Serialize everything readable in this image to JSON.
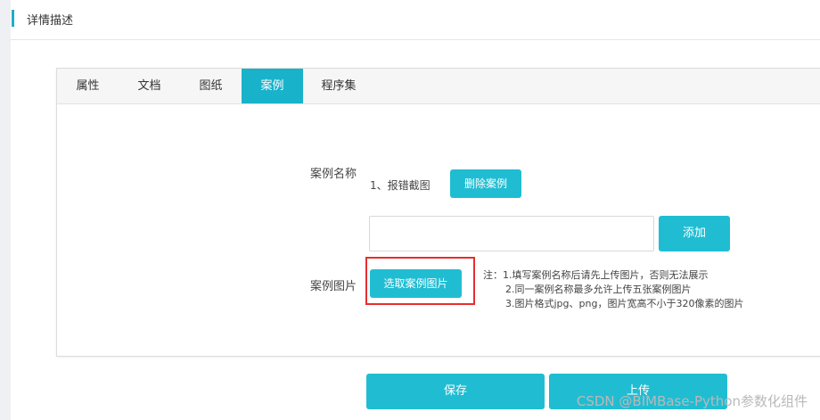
{
  "header": {
    "title": "详情描述"
  },
  "tabs": [
    {
      "label": "属性",
      "active": false
    },
    {
      "label": "文档",
      "active": false
    },
    {
      "label": "图纸",
      "active": false
    },
    {
      "label": "案例",
      "active": true
    },
    {
      "label": "程序集",
      "active": false
    }
  ],
  "case": {
    "name_label": "案例名称",
    "current_case": "1、报错截图",
    "delete_label": "删除案例",
    "name_input_value": "",
    "add_label": "添加",
    "image_label": "案例图片",
    "select_image_label": "选取案例图片",
    "notes": [
      "注：1.填写案例名称后请先上传图片，否则无法展示",
      "2.同一案例名称最多允许上传五张案例图片",
      "3.图片格式jpg、png，图片宽高不小于320像素的图片"
    ]
  },
  "footer": {
    "save_label": "保存",
    "upload_label": "上传"
  },
  "watermark": "CSDN @BIMBase-Python参数化组件",
  "colors": {
    "accent": "#1bb0c8",
    "highlight": "#e62e2e"
  }
}
